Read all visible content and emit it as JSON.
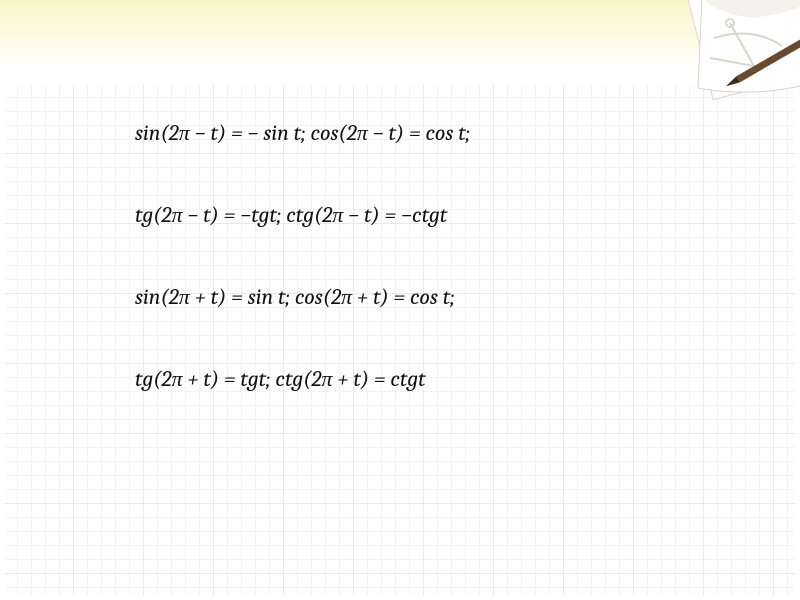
{
  "formulas": {
    "f1": "sin(2π − t) = − sin t;  cos(2π − t) = cos t;",
    "f2": "tg(2π − t) = −tgt; ctg(2π − t) = −ctgt",
    "f3": "sin(2π + t) = sin t;  cos(2π + t) = cos t;",
    "f4": "tg(2π + t) = tgt; ctg(2π + t) = ctgt"
  },
  "decor": {
    "corner_icon": "notepad-pencil-icon"
  }
}
